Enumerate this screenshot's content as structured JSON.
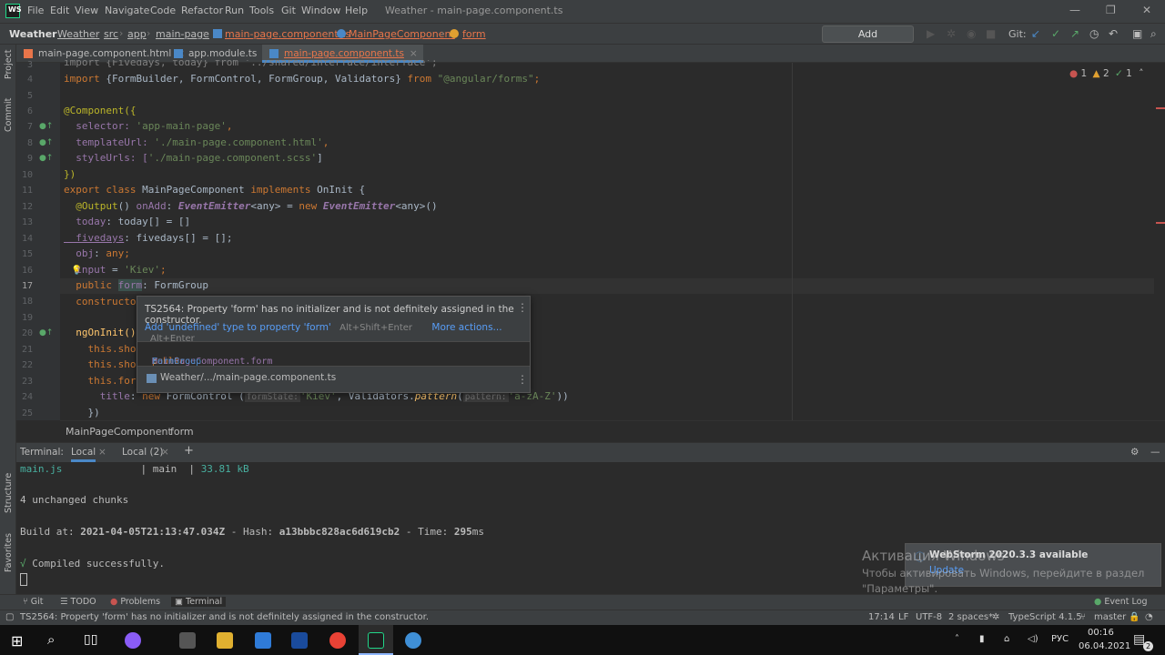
{
  "window": {
    "app_logo": "WS",
    "menu": [
      "File",
      "Edit",
      "View",
      "Navigate",
      "Code",
      "Refactor",
      "Run",
      "Tools",
      "Git",
      "Window",
      "Help"
    ],
    "title": "Weather - main-page.component.ts"
  },
  "navbar": {
    "crumbs": [
      "Weather",
      "Weather",
      "src",
      "app",
      "main-page",
      "main-page.component.ts",
      "MainPageComponent",
      "form"
    ],
    "add_config": "Add Configuration...",
    "git_label": "Git:"
  },
  "tabs": [
    {
      "label": "main-page.component.html",
      "icon": "html-file-icon",
      "color": "#e8754a"
    },
    {
      "label": "app.module.ts",
      "icon": "ts-file-icon",
      "color": "#4a88c7"
    },
    {
      "label": "main-page.component.ts",
      "icon": "ts-file-icon",
      "color": "#4a88c7"
    }
  ],
  "left_strip": [
    "Project",
    "Commit",
    "Structure",
    "Favorites"
  ],
  "code": {
    "line_numbers": [
      "3",
      "4",
      "5",
      "6",
      "7",
      "8",
      "9",
      "10",
      "11",
      "12",
      "13",
      "14",
      "15",
      "16",
      "17",
      "18",
      "19",
      "20",
      "21",
      "22",
      "23",
      "24",
      "25"
    ],
    "l3": "import {Fivedays, today} from '../shared/interface/interface';",
    "l4a": "import ",
    "l4b": "{FormBuilder, FormControl, FormGroup, Validators} ",
    "l4c": "from ",
    "l4d": "\"@angular/forms\"",
    "l4e": ";",
    "l6": "@Component({",
    "l7a": "  selector: ",
    "l7b": "'app-main-page'",
    "l7c": ",",
    "l8a": "  templateUrl: ",
    "l8b": "'./main-page.component.html'",
    "l8c": ",",
    "l9a": "  styleUrls: [",
    "l9b": "'./main-page.component.scss'",
    "l9c": "]",
    "l10": "})",
    "l11a": "export class ",
    "l11b": "MainPageComponent ",
    "l11c": "implements ",
    "l11d": "OnInit {",
    "l12a": "  @Output",
    "l12b": "() ",
    "l12c": "onAdd",
    "l12d": ": ",
    "l12e": "EventEmitter",
    "l12f": "<any> = ",
    "l12g": "new ",
    "l12h": "EventEmitter",
    "l12i": "<any>()",
    "l13a": "  today",
    "l13b": ": today[] = []",
    "l14a": "  fivedays",
    "l14b": ": fivedays[] = [];",
    "l15a": "  obj",
    "l15b": ": ",
    "l15c": "any",
    "l15d": ";",
    "l16a": "  input ",
    "l16b": "= ",
    "l16c": "'Kiev'",
    "l16d": ";",
    "l17a": "  public ",
    "l17b": "form",
    "l17c": ": FormGroup",
    "l18a": "  constructo",
    "l20": "  ngOnInit()",
    "l21": "    this.sho",
    "l22": "    this.sho",
    "l23": "    this.for",
    "l24a": "      title",
    "l24b": ": ",
    "l24c": "new ",
    "l24d": "FormControl (",
    "l24e": "formState:",
    "l24f": "'Kiev'",
    "l24g": ", Validators.",
    "l24h": "pattern",
    "l24i": "(",
    "l24j": "pattern:",
    "l24k": "'a-zA-Z'",
    "l24l": "))",
    "l25": "    })"
  },
  "inspections": {
    "errors": "1",
    "warnings": "2",
    "weak": "1"
  },
  "popup": {
    "message": "TS2564: Property 'form' has no initializer and is not definitely assigned in the constructor.",
    "fix": "Add 'undefined' type to property 'form'",
    "fix_key": "Alt+Shift+Enter",
    "more": "More actions...",
    "more_key": "Alt+Enter",
    "decl_kw": "public ",
    "decl_name": "MainPageComponent.form",
    "decl_sep": ": ",
    "decl_type": "FormGroup",
    "path": "Weather/.../main-page.component.ts"
  },
  "editor_crumb": [
    "MainPageComponent",
    "form"
  ],
  "terminal": {
    "label": "Terminal:",
    "tabs": [
      "Local",
      "Local (2)"
    ],
    "add": "+",
    "lines": {
      "l1a": "main.js",
      "l1b": "             | main  | ",
      "l1c": "33.81 kB",
      "l2": "4 unchanged chunks",
      "l3a": "Build at: ",
      "l3b": "2021-04-05T21:13:47.034Z",
      "l3c": " - Hash: ",
      "l3d": "a13bbbc828ac6d619cb2",
      "l3e": " - Time: ",
      "l3f": "295",
      "l3g": "ms",
      "l4a": "√",
      "l4b": " Compiled successfully."
    }
  },
  "toolwindows": [
    "Git",
    "TODO",
    "Problems",
    "Terminal"
  ],
  "event_log": "Event Log",
  "status": {
    "message": "TS2564: Property 'form' has no initializer and is not definitely assigned in the constructor.",
    "position": "17:14",
    "line_sep": "LF",
    "encoding": "UTF-8",
    "indent": "2 spaces*",
    "language": "TypeScript 4.1.5",
    "branch": "master"
  },
  "notification": {
    "title": "WebStorm 2020.3.3 available",
    "link": "Update"
  },
  "watermark": {
    "title": "Активация Windows",
    "line1": "Чтобы активировать Windows, перейдите в раздел",
    "line2": "\"Параметры\"."
  },
  "taskbar": {
    "lang": "РУС",
    "time": "00:16",
    "date": "06.04.2021",
    "notif_count": "2"
  }
}
